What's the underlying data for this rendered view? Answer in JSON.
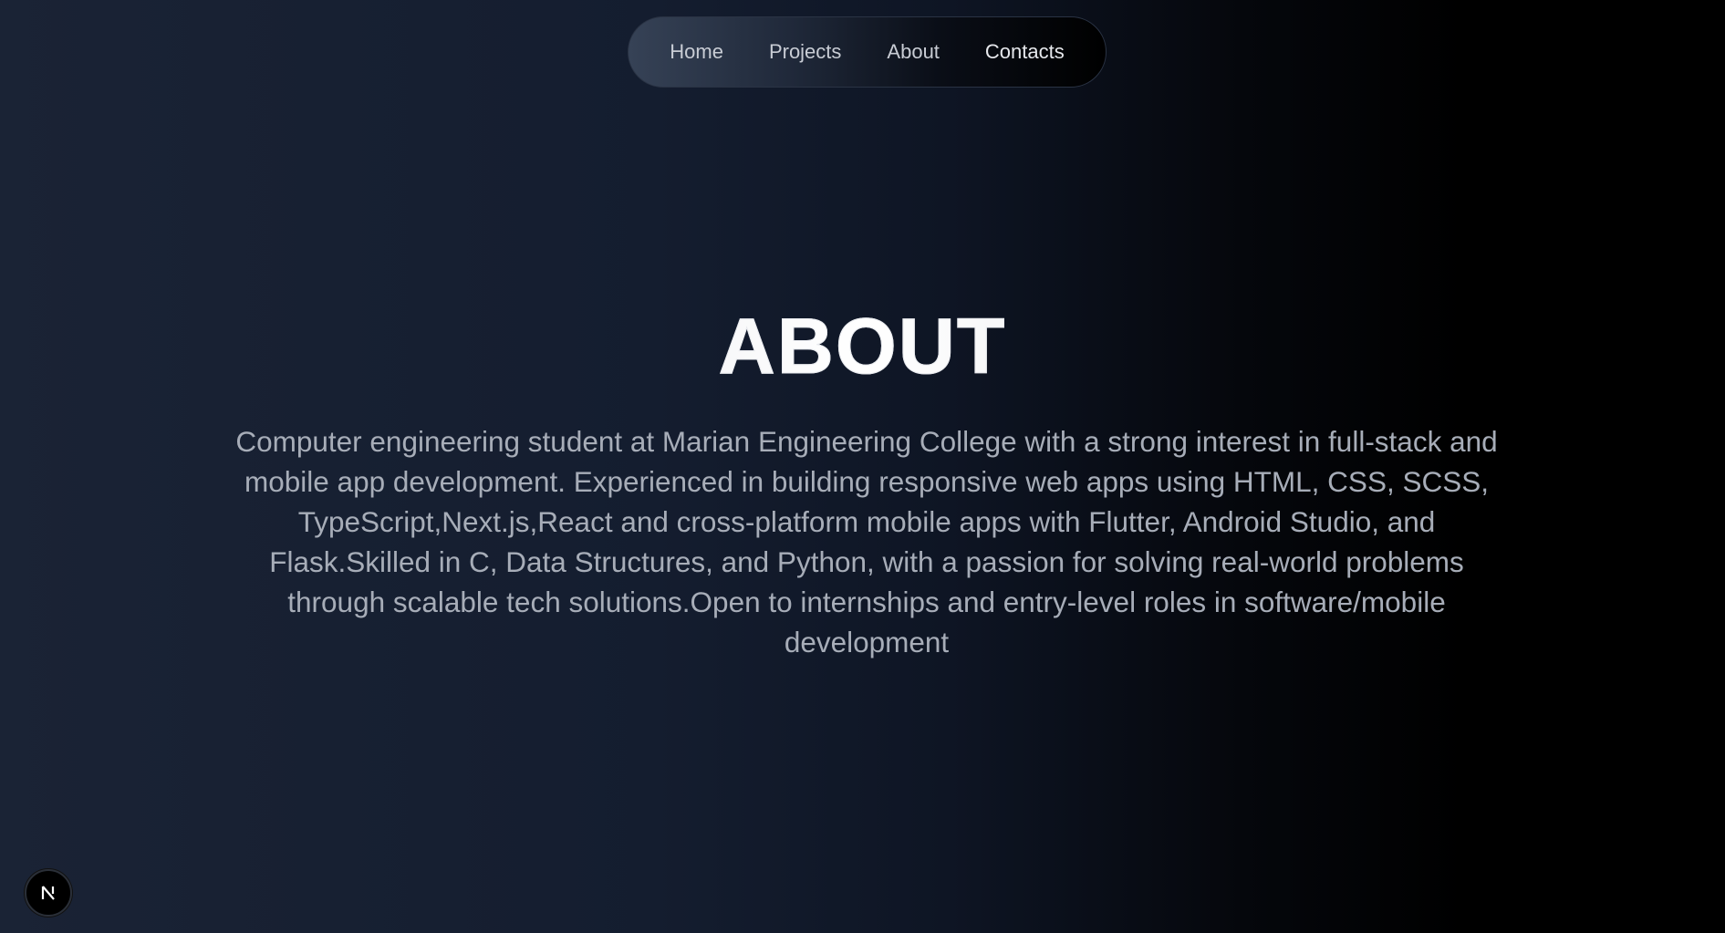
{
  "nav": {
    "items": [
      {
        "label": "Home"
      },
      {
        "label": "Projects"
      },
      {
        "label": "About"
      },
      {
        "label": "Contacts"
      }
    ]
  },
  "about": {
    "title": "ABOUT",
    "text": "Computer engineering student at Marian Engineering College with a strong interest in full-stack and mobile app development. Experienced in building responsive web apps using HTML, CSS, SCSS, TypeScript,Next.js,React and cross-platform mobile apps with Flutter, Android Studio, and Flask.Skilled in C, Data Structures, and Python, with a passion for solving real-world problems through scalable tech solutions.Open to internships and entry-level roles in software/mobile development"
  },
  "badge": {
    "icon": "nextjs-logo-icon",
    "letter": "N"
  },
  "colors": {
    "background_start": "#1a2335",
    "background_end": "#000000",
    "text_muted": "#a7adb8",
    "nav_text": "#c8ccd4"
  }
}
